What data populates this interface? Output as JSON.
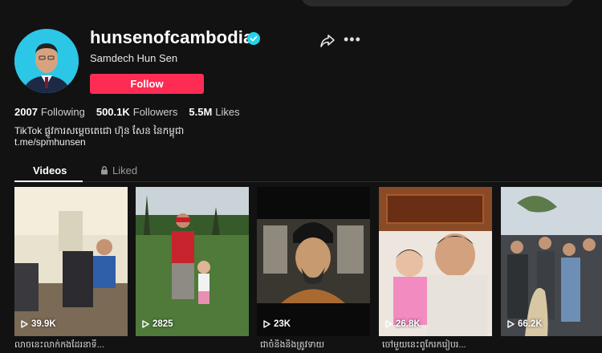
{
  "profile": {
    "username": "hunsenofcambodia",
    "nickname": "Samdech Hun Sen",
    "follow_label": "Follow",
    "bio_line1": "TikTok ផ្លូវការសម្តេចតេជោ ហ៊ុន សែន នៃកម្ពុជា",
    "bio_line2": "t.me/spmhunsen"
  },
  "stats": [
    {
      "value": "2007",
      "label": "Following"
    },
    {
      "value": "500.1K",
      "label": "Followers"
    },
    {
      "value": "5.5M",
      "label": "Likes"
    }
  ],
  "tabs": {
    "videos": "Videos",
    "liked": "Liked"
  },
  "videos": [
    {
      "views": "39.9K",
      "caption": "លាចនេះលាក់កងដែរនាទី..."
    },
    {
      "views": "2825",
      "caption": ""
    },
    {
      "views": "23K",
      "caption": "ជាចំនិងនិងត្រូវទាយ"
    },
    {
      "views": "26.8K",
      "caption": "ចៅមួយនេះពូកែរករៀបរ..."
    },
    {
      "views": "66.2K",
      "caption": ""
    }
  ],
  "icons": {
    "verified": "verified-check-icon",
    "share": "share-arrow-icon",
    "more": "more-dots-icon",
    "lock": "lock-icon",
    "play": "play-icon"
  },
  "colors": {
    "background": "#121212",
    "follow_button": "#fe2c55",
    "verified": "#20d5ec"
  }
}
